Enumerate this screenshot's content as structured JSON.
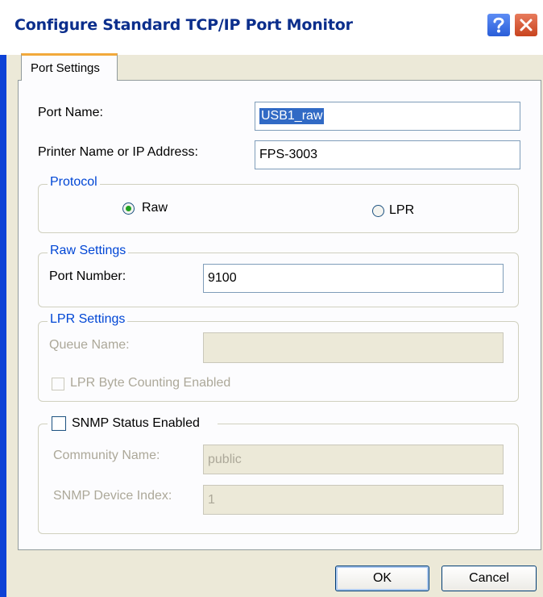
{
  "window": {
    "title": "Configure Standard TCP/IP Port Monitor",
    "help_icon": "question-mark-icon",
    "close_icon": "close-x-icon"
  },
  "tabs": [
    {
      "label": "Port Settings",
      "active": true
    }
  ],
  "port_settings": {
    "port_name_label": "Port Name:",
    "port_name_value": "USB1_raw",
    "printer_label": "Printer Name or IP Address:",
    "printer_value": "FPS-3003"
  },
  "protocol": {
    "legend": "Protocol",
    "options": [
      {
        "label": "Raw",
        "selected": true
      },
      {
        "label": "LPR",
        "selected": false
      }
    ]
  },
  "raw_settings": {
    "legend": "Raw Settings",
    "port_number_label": "Port Number:",
    "port_number_value": "9100"
  },
  "lpr_settings": {
    "legend": "LPR Settings",
    "queue_name_label": "Queue Name:",
    "queue_name_value": "",
    "byte_counting_label": "LPR Byte Counting Enabled",
    "byte_counting_checked": false
  },
  "snmp": {
    "enabled_label": "SNMP Status Enabled",
    "enabled_checked": false,
    "community_label": "Community Name:",
    "community_value": "public",
    "device_index_label": "SNMP Device Index:",
    "device_index_value": "1"
  },
  "buttons": {
    "ok": "OK",
    "cancel": "Cancel"
  },
  "colors": {
    "title_text": "#0b2e8c",
    "legend_text": "#0046d5",
    "tab_highlight": "#f2a93b",
    "close_button": "#c8441f",
    "help_button": "#2a5ed8",
    "selection": "#316ac5"
  }
}
